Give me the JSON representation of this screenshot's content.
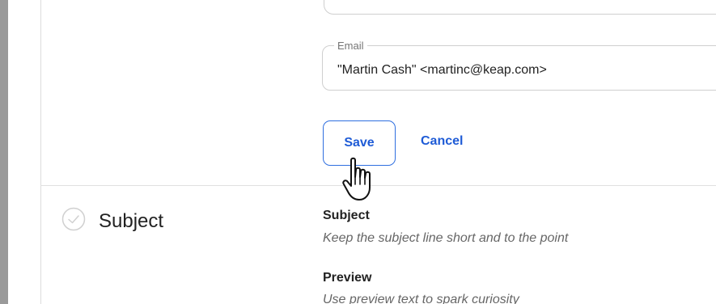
{
  "email_field": {
    "legend": "Email",
    "value": "\"Martin Cash\" <martinc@keap.com>"
  },
  "actions": {
    "save_label": "Save",
    "cancel_label": "Cancel"
  },
  "subject_section": {
    "title": "Subject",
    "subject_label": "Subject",
    "subject_hint": "Keep the subject line short and to the point",
    "preview_label": "Preview",
    "preview_hint": "Use preview text to spark curiosity"
  },
  "icons": {
    "section_status": "check-circle-icon",
    "pointer": "hand-pointer-icon"
  },
  "colors": {
    "accent": "#1e5bd6",
    "field_border": "#cfcfcf",
    "backdrop": "#9a9a9a"
  }
}
